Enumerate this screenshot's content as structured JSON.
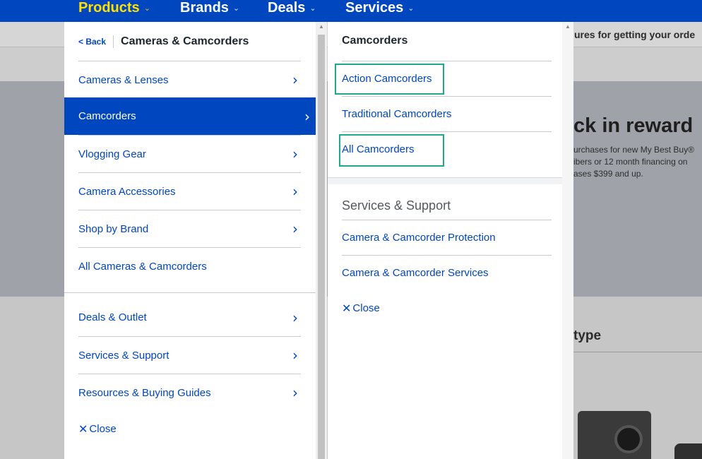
{
  "nav": {
    "items": [
      {
        "label": "Products",
        "active": true
      },
      {
        "label": "Brands",
        "active": false
      },
      {
        "label": "Deals",
        "active": false
      },
      {
        "label": "Services",
        "active": false
      }
    ],
    "chevron_icon": "chevron-down-icon"
  },
  "background_page": {
    "banner_text": "ures for getting your orde",
    "hero_heading": "ck in reward",
    "hero_line1": "urchases for new My Best Buy®",
    "hero_line2": "ibers or 12 month financing on",
    "hero_line3": "ases $399 and up.",
    "section_heading": "type"
  },
  "left_menu": {
    "back_label": "< Back",
    "title": "Cameras & Camcorders",
    "items": [
      {
        "label": "Cameras & Lenses",
        "has_submenu": true
      },
      {
        "label": "Camcorders",
        "has_submenu": true,
        "selected": true
      },
      {
        "label": "Vlogging Gear",
        "has_submenu": true
      },
      {
        "label": "Camera Accessories",
        "has_submenu": true
      },
      {
        "label": "Shop by Brand",
        "has_submenu": true
      },
      {
        "label": "All Cameras & Camcorders",
        "has_submenu": false
      }
    ],
    "secondary_items": [
      {
        "label": "Deals & Outlet",
        "has_submenu": true
      },
      {
        "label": "Services & Support",
        "has_submenu": true
      },
      {
        "label": "Resources & Buying Guides",
        "has_submenu": true
      }
    ],
    "close_label": "Close"
  },
  "right_menu": {
    "title": "Camcorders",
    "items": [
      {
        "label": "Action Camcorders",
        "highlighted": true
      },
      {
        "label": "Traditional Camcorders",
        "highlighted": false
      },
      {
        "label": "All Camcorders",
        "highlighted": true
      }
    ],
    "section_title": "Services & Support",
    "section_items": [
      {
        "label": "Camera & Camcorder Protection"
      },
      {
        "label": "Camera & Camcorder Services"
      }
    ],
    "close_label": "Close"
  },
  "colors": {
    "brand_blue": "#0046be",
    "active_yellow": "#ffe000",
    "highlight_green": "#22a88c"
  }
}
